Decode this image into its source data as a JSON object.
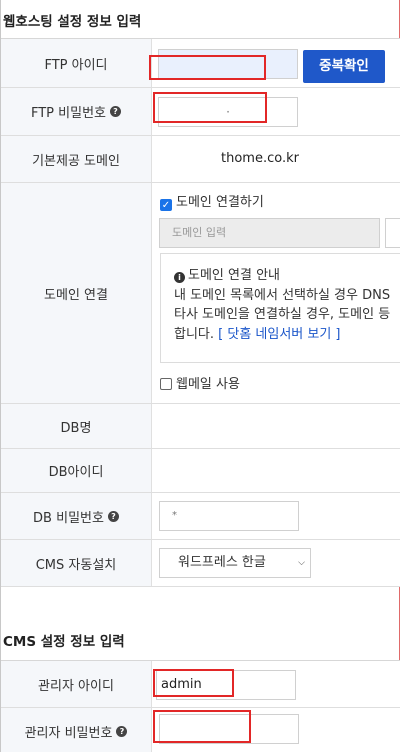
{
  "hosting": {
    "title": "웹호스팅 설정 정보 입력",
    "ftp_id": {
      "label": "FTP 아이디",
      "value": "",
      "check_button": "중복확인"
    },
    "ftp_pw": {
      "label": "FTP 비밀번호",
      "value": "·"
    },
    "base_domain": {
      "label": "기본제공 도메인",
      "value": "thome.co.kr"
    },
    "domain": {
      "label": "도메인 연결",
      "checkbox_label": "도메인 연결하기",
      "input_placeholder": "도메인 입력",
      "info_title": "도메인 연결 안내",
      "info_line1": "내 도메인 목록에서 선택하실 경우 DNS",
      "info_line2": "타사 도메인을 연결하실 경우, 도메인 등",
      "info_line3_prefix": "합니다.",
      "info_link": "[ 닷홈 네임서버 보기 ]",
      "webmail_label": "웹메일 사용"
    },
    "db_name": {
      "label": "DB명"
    },
    "db_id": {
      "label": "DB아이디"
    },
    "db_pw": {
      "label": "DB 비밀번호",
      "value": "*"
    },
    "cms": {
      "label": "CMS 자동설치",
      "selected": "워드프레스 한글"
    }
  },
  "cms_settings": {
    "title": "CMS 설정 정보 입력",
    "admin_id": {
      "label": "관리자 아이디",
      "value": "admin"
    },
    "admin_pw": {
      "label": "관리자 비밀번호",
      "value": ""
    }
  }
}
